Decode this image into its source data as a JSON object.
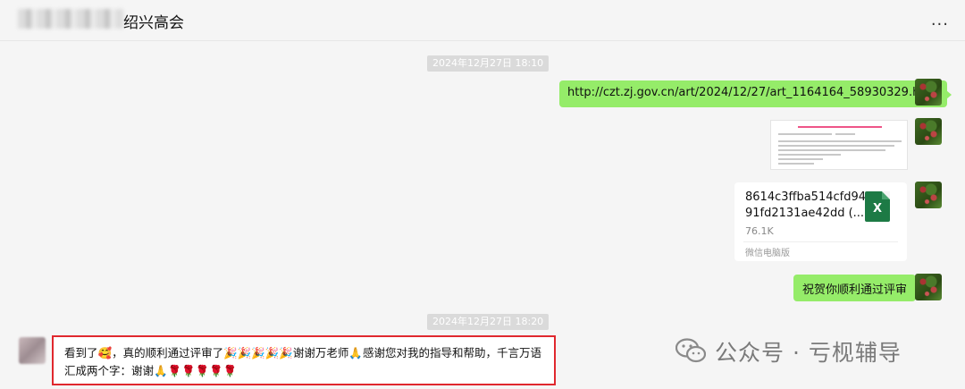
{
  "header": {
    "title": "绍兴高会",
    "more_label": "..."
  },
  "timestamps": [
    "2024年12月27日 18:10",
    "2024年12月27日 18:20"
  ],
  "messages": {
    "link_text": "http://czt.zj.gov.cn/art/2024/12/27/art_1164164_58930329.html",
    "file": {
      "name": "8614c3ffba514cfd94 91fd2131ae42dd (...",
      "size": "76.1K",
      "source": "微信电脑版",
      "icon_letter": "X"
    },
    "congrats_text": "祝贺你顺利通过评审",
    "reply_text": "看到了🥰，真的顺利通过评审了🎉🎉🎉🎉🎉谢谢万老师🙏感谢您对我的指导和帮助，千言万语汇成两个字：谢谢🙏🌹🌹🌹🌹🌹"
  },
  "watermark": {
    "text": "公众号 · 亏枧辅导"
  },
  "colors": {
    "bubble_green": "#95ec69",
    "highlight_border": "#e0282e",
    "excel_green": "#1d7a45"
  }
}
